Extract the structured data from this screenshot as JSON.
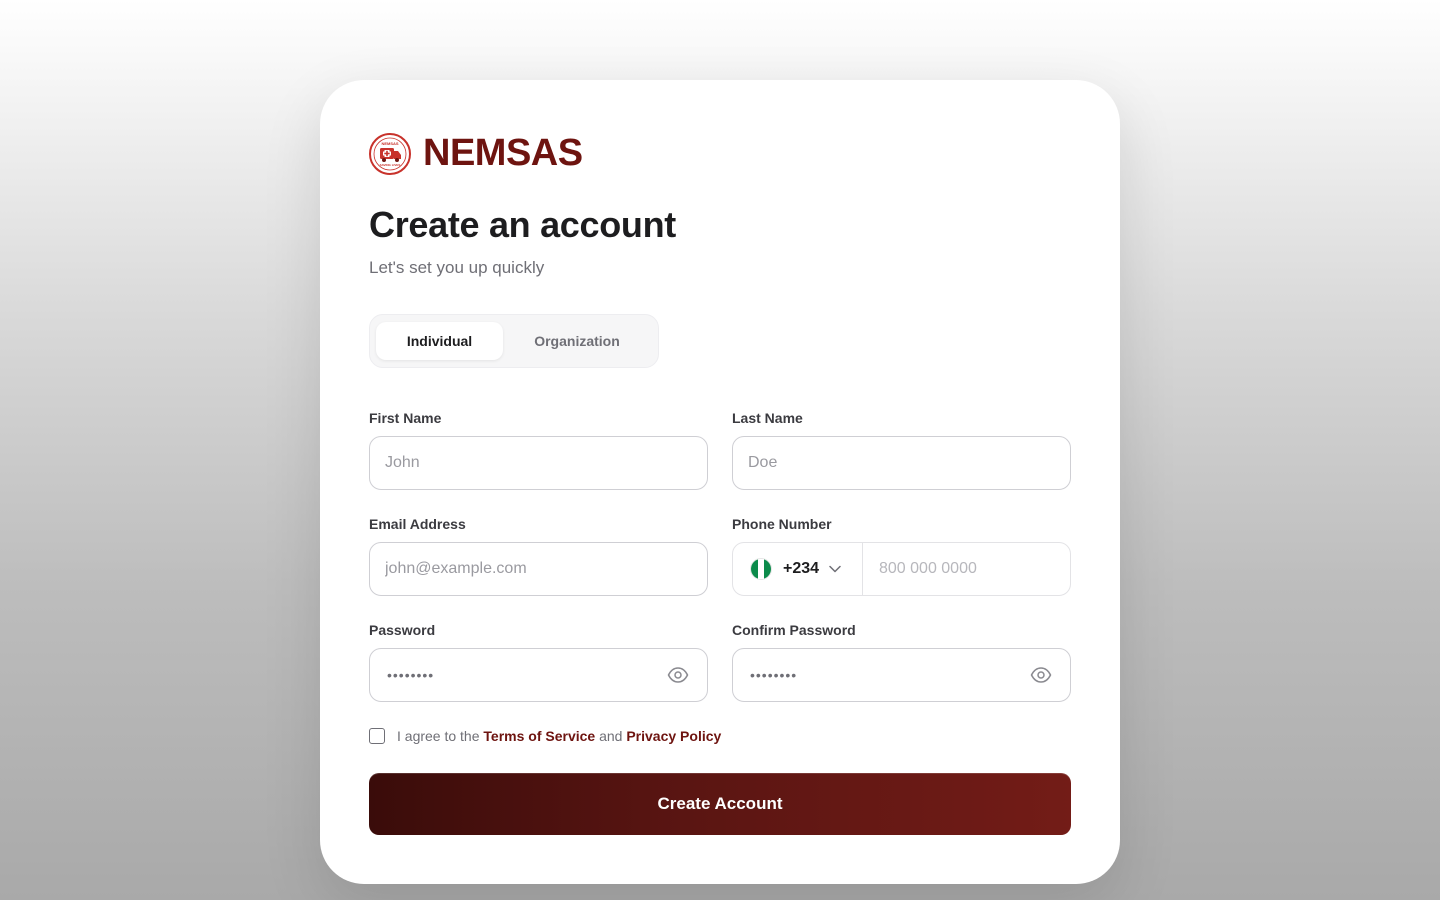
{
  "brand": {
    "name": "NEMSAS",
    "logo_icon": "ambulance-icon",
    "logo_text_top": "NEMSAS",
    "logo_text_bottom": "SAVING LIVES",
    "color": "#6e1410"
  },
  "header": {
    "title": "Create an account",
    "subtitle": "Let's set you up quickly"
  },
  "account_type": {
    "options": [
      "Individual",
      "Organization"
    ],
    "selected": "Individual"
  },
  "form": {
    "first_name": {
      "label": "First Name",
      "placeholder": "John",
      "value": ""
    },
    "last_name": {
      "label": "Last Name",
      "placeholder": "Doe",
      "value": ""
    },
    "email": {
      "label": "Email Address",
      "placeholder": "john@example.com",
      "value": ""
    },
    "phone": {
      "label": "Phone Number",
      "country_code": "+234",
      "flag_icon": "nigeria-flag-icon",
      "placeholder": "800 000 0000",
      "value": ""
    },
    "password": {
      "label": "Password",
      "masked": "••••••••",
      "toggle_icon": "eye-icon"
    },
    "confirm_password": {
      "label": "Confirm Password",
      "masked": "••••••••",
      "toggle_icon": "eye-icon"
    }
  },
  "agreement": {
    "prefix": "I agree to the",
    "terms": "Terms of Service",
    "conjunction": "and",
    "privacy": "Privacy Policy",
    "checked": false
  },
  "submit": {
    "label": "Create Account"
  },
  "colors": {
    "accent": "#6e1410",
    "button_start": "#3a0c0a",
    "button_end": "#731c17",
    "flag_green": "#0b8a4a"
  }
}
